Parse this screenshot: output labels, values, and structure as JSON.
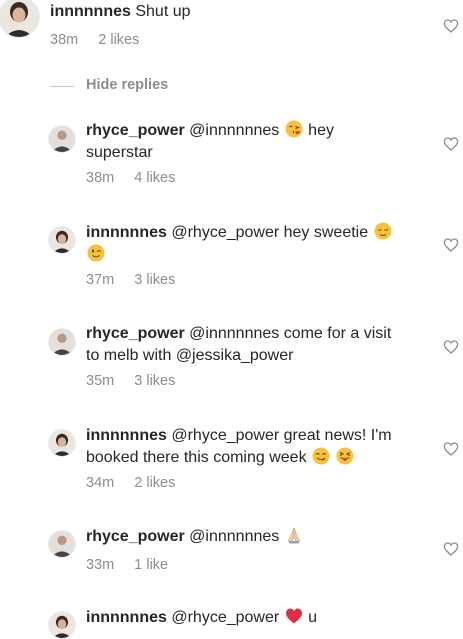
{
  "top_comment": {
    "username": "innnnnnes",
    "text": "Shut up",
    "time": "38m",
    "likes": "2 likes",
    "avatar_icon": "avatar-innnnnnes"
  },
  "hide_replies": "Hide replies",
  "replies": [
    {
      "username": "rhyce_power",
      "line1": "@innnnnnes",
      "emoji1": "face-blowing-kiss",
      "after1": "hey",
      "line2": "superstar",
      "time": "38m",
      "likes": "4 likes"
    },
    {
      "username": "innnnnnes",
      "line1": "@rhyce_power hey sweetie",
      "emoji1": "relieved-face",
      "emoji2": "winking-face",
      "time": "37m",
      "likes": "3 likes"
    },
    {
      "username": "rhyce_power",
      "line1": "@innnnnnes come for a visit",
      "line2": "to melb with @jessika_power",
      "time": "35m",
      "likes": "3 likes"
    },
    {
      "username": "innnnnnes",
      "line1": "@rhyce_power great news! I'm",
      "line2": "booked there this coming week",
      "emoji1": "face-savoring-food",
      "emoji2": "squinting-tongue-face",
      "time": "34m",
      "likes": "2 likes"
    },
    {
      "username": "rhyce_power",
      "line1": "@innnnnnes",
      "emoji1": "folded-hands",
      "time": "33m",
      "likes": "1 like"
    },
    {
      "username": "innnnnnes",
      "line1": "@rhyce_power",
      "emoji1": "red-heart",
      "after1": "u"
    }
  ],
  "icons": {
    "like": "heart-outline-icon"
  },
  "colors": {
    "text": "#262626",
    "muted": "#8e8e8e",
    "emoji_yellow": "#f7c23b",
    "heart_red": "#dd2e44"
  }
}
